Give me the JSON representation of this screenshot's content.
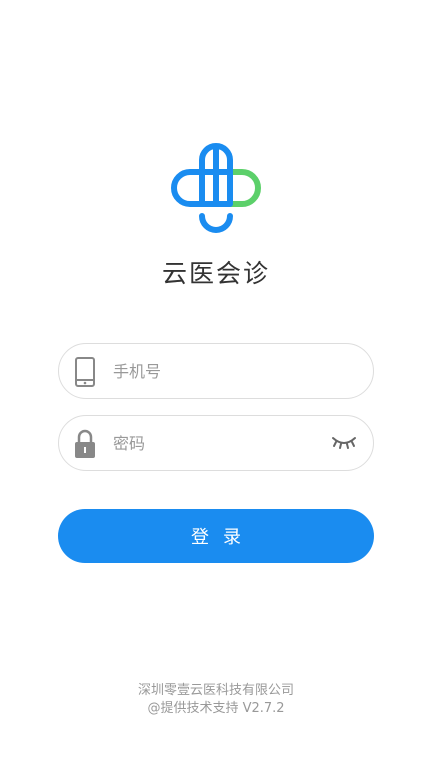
{
  "app": {
    "title": "云医会诊"
  },
  "form": {
    "phone": {
      "placeholder": "手机号",
      "value": "",
      "icon": "phone-icon"
    },
    "password": {
      "placeholder": "密码",
      "value": "",
      "icon": "lock-icon",
      "toggle_icon": "eye-closed-icon"
    },
    "login_label": "登录"
  },
  "footer": {
    "company": "深圳零壹云医科技有限公司",
    "support": "@提供技术支持 V2.7.2"
  },
  "colors": {
    "primary": "#1a8cf0",
    "logo_blue": "#1a8cf0",
    "logo_green": "#5cd06a",
    "text": "#333333",
    "muted": "#999999",
    "border": "#dddddd"
  }
}
